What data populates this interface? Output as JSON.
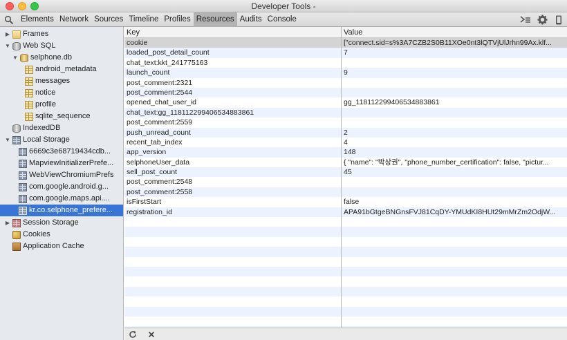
{
  "window": {
    "title": "Developer Tools -"
  },
  "toolbar": {
    "tabs": [
      {
        "label": "Elements"
      },
      {
        "label": "Network"
      },
      {
        "label": "Sources"
      },
      {
        "label": "Timeline"
      },
      {
        "label": "Profiles"
      },
      {
        "label": "Resources",
        "active": true
      },
      {
        "label": "Audits"
      },
      {
        "label": "Console"
      }
    ],
    "icons": [
      "search-icon",
      "dock-console-icon",
      "gear-icon",
      "device-icon"
    ]
  },
  "sidebar": {
    "frames": "Frames",
    "websql": "Web SQL",
    "database": "selphone.db",
    "tables": [
      "android_metadata",
      "messages",
      "notice",
      "profile",
      "sqlite_sequence"
    ],
    "indexeddb": "IndexedDB",
    "local_storage": "Local Storage",
    "local_storage_items": [
      "6669c3e68719434cdb...",
      "MapviewInitializerPrefe...",
      "WebViewChromiumPrefs",
      "com.google.android.g...",
      "com.google.maps.api....",
      "kr.co.selphone_prefere..."
    ],
    "session_storage": "Session Storage",
    "cookies": "Cookies",
    "application_cache": "Application Cache"
  },
  "grid": {
    "columns": {
      "key": "Key",
      "value": "Value"
    },
    "rows": [
      {
        "key": "cookie",
        "value": "[\"connect.sid=s%3A7CZB2S0B11XOe0nt3lQTVjUlJrhn99Ax.klf..."
      },
      {
        "key": "loaded_post_detail_count",
        "value": "7"
      },
      {
        "key": "chat_text:kkt_241775163",
        "value": ""
      },
      {
        "key": "launch_count",
        "value": "9"
      },
      {
        "key": "post_comment:2321",
        "value": ""
      },
      {
        "key": "post_comment:2544",
        "value": ""
      },
      {
        "key": "opened_chat_user_id",
        "value": "gg_118112299406534883861"
      },
      {
        "key": "chat_text:gg_118112299406534883861",
        "value": ""
      },
      {
        "key": "post_comment:2559",
        "value": ""
      },
      {
        "key": "push_unread_count",
        "value": "2"
      },
      {
        "key": "recent_tab_index",
        "value": "4"
      },
      {
        "key": "app_version",
        "value": "148"
      },
      {
        "key": "selphoneUser_data",
        "value": "{ \"name\": \"박상권\", \"phone_number_certification\": false, \"pictur..."
      },
      {
        "key": "sell_post_count",
        "value": "45"
      },
      {
        "key": "post_comment:2548",
        "value": ""
      },
      {
        "key": "post_comment:2558",
        "value": ""
      },
      {
        "key": "isFirstStart",
        "value": "false"
      },
      {
        "key": "registration_id",
        "value": "APA91bGtgeBNGnsFVJ81CqDY-YMUdKI8HUt29mMrZm2OdjW..."
      }
    ],
    "empty_row_count": 12
  },
  "footer": {
    "icons": [
      "refresh-icon",
      "delete-icon"
    ]
  },
  "colors": {
    "selection": "#3875d7",
    "stripe": "#edf3fe",
    "selected_row": "#d4d4d4"
  }
}
